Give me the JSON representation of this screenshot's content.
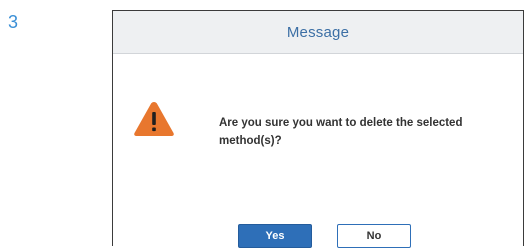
{
  "step_number": "3",
  "dialog": {
    "title": "Message",
    "message": "Are you sure you want to delete the selected method(s)?",
    "icon": "warning-icon",
    "buttons": {
      "yes_label": "Yes",
      "no_label": "No"
    }
  },
  "colors": {
    "step_number": "#3a8fd6",
    "title_text": "#3c6fa5",
    "title_bar": "#eef0f2",
    "warning": "#e8772e",
    "primary_button": "#2e6fb8"
  }
}
